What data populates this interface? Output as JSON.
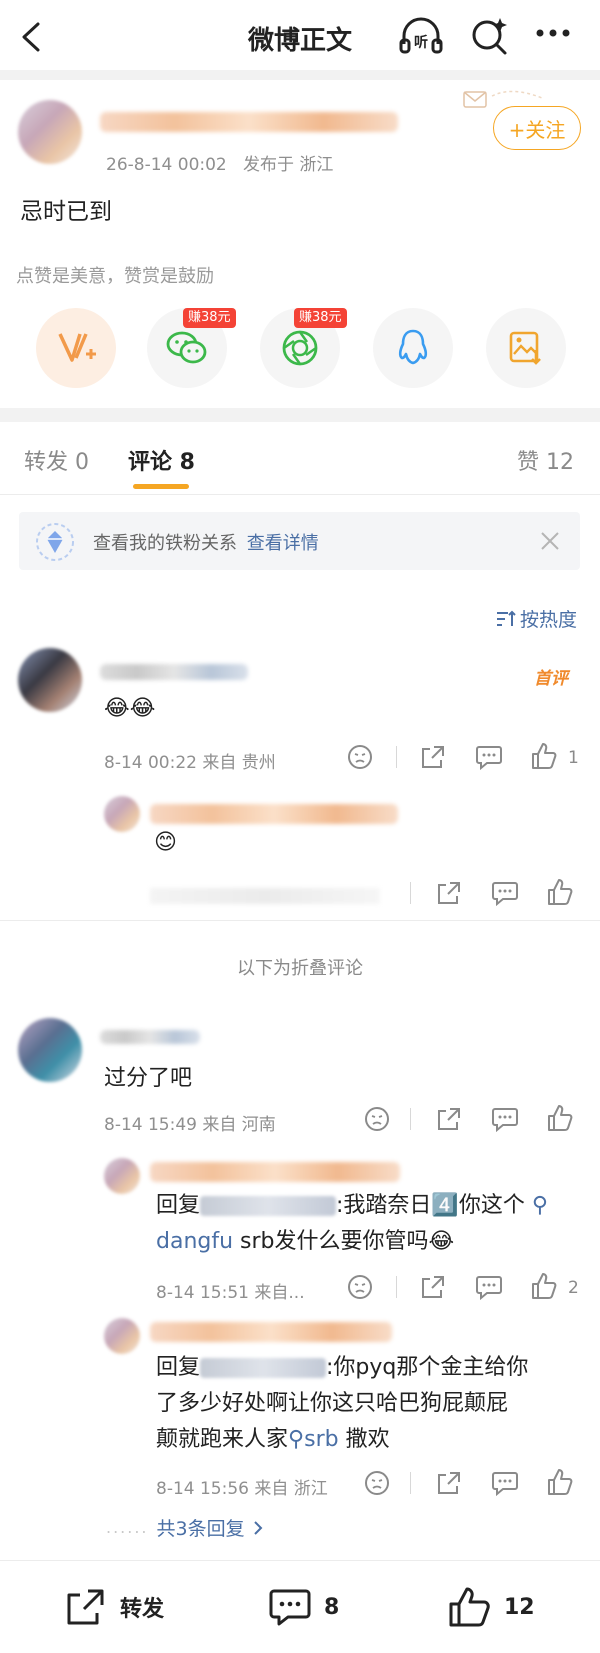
{
  "header": {
    "title": "微博正文",
    "back_icon": "chevron-left-icon",
    "listen_label": "听",
    "more_icon": "more-dots-icon"
  },
  "post": {
    "timestamp": "26-8-14 00:02",
    "published_from": "发布于 浙江",
    "content": "忌时已到",
    "follow_label": "+关注",
    "reward_hint": "点赞是美意，赞赏是鼓励"
  },
  "share": {
    "items": [
      {
        "icon": "vplus-icon",
        "badge": ""
      },
      {
        "icon": "wechat-icon",
        "badge": "赚38元"
      },
      {
        "icon": "moments-icon",
        "badge": "赚38元"
      },
      {
        "icon": "qq-icon",
        "badge": ""
      },
      {
        "icon": "save-image-icon",
        "badge": ""
      }
    ]
  },
  "tabs": {
    "repost": "转发 0",
    "comments": "评论 8",
    "likes": "赞 12"
  },
  "banner": {
    "text": "查看我的铁粉关系",
    "link": "查看详情"
  },
  "sort_label": "按热度",
  "comments": [
    {
      "badge": "首评",
      "text": "😂😂",
      "meta": "8-14 00:22  来自 贵州",
      "likes": "1",
      "reply": {
        "text": "😊"
      }
    }
  ],
  "folded_label": "以下为折叠评论",
  "folded_comment": {
    "text": "过分了吧",
    "meta": "8-14 15:49  来自 河南",
    "replies": [
      {
        "prefix": "回复",
        "line1_rest": ":我踏奈日4️⃣你这个",
        "link1": "dangfu",
        "line2_rest": " srb发什么要你管吗😂",
        "meta": "8-14 15:51  来自...",
        "likes": "2"
      },
      {
        "prefix": "回复",
        "line1_rest": ":你pyq那个金主给你",
        "line2": "了多少好处啊让你这只哈巴狗屁颠屁",
        "line3_pre": "颠就跑来人家",
        "link": "srb",
        "line3_post": " 撒欢",
        "meta": "8-14 15:56  来自 浙江"
      }
    ],
    "more_replies": "共3条回复"
  },
  "bottom": {
    "repost": "转发",
    "comments": "8",
    "likes": "12"
  },
  "colors": {
    "accent_orange": "#f5a623",
    "link_blue": "#4a6fa5",
    "badge_red": "#f44336"
  }
}
